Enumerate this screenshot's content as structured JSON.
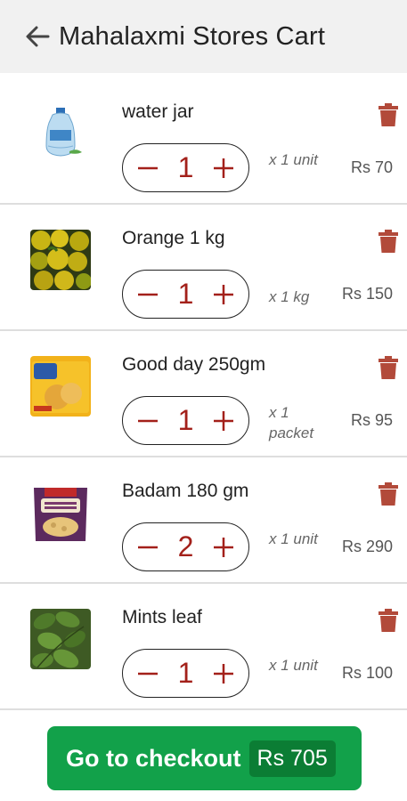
{
  "header": {
    "title": "Mahalaxmi Stores Cart",
    "back_icon": "arrow-left-icon"
  },
  "items": [
    {
      "name": "water jar",
      "quantity": "1",
      "unit": "x 1 unit",
      "price": "Rs 70"
    },
    {
      "name": "Orange 1 kg",
      "quantity": "1",
      "unit": "x 1 kg",
      "price": "Rs 150"
    },
    {
      "name": "Good day 250gm",
      "quantity": "1",
      "unit": "x 1 packet",
      "price": "Rs 95"
    },
    {
      "name": "Badam 180 gm",
      "quantity": "2",
      "unit": "x 1 unit",
      "price": "Rs 290"
    },
    {
      "name": "Mints leaf",
      "quantity": "1",
      "unit": "x 1 unit",
      "price": "Rs 100"
    }
  ],
  "checkout": {
    "label": "Go to checkout",
    "total": "Rs 705"
  },
  "colors": {
    "accent_red": "#a3201a",
    "trash": "#b24a3a",
    "checkout_green": "#12a14a"
  }
}
